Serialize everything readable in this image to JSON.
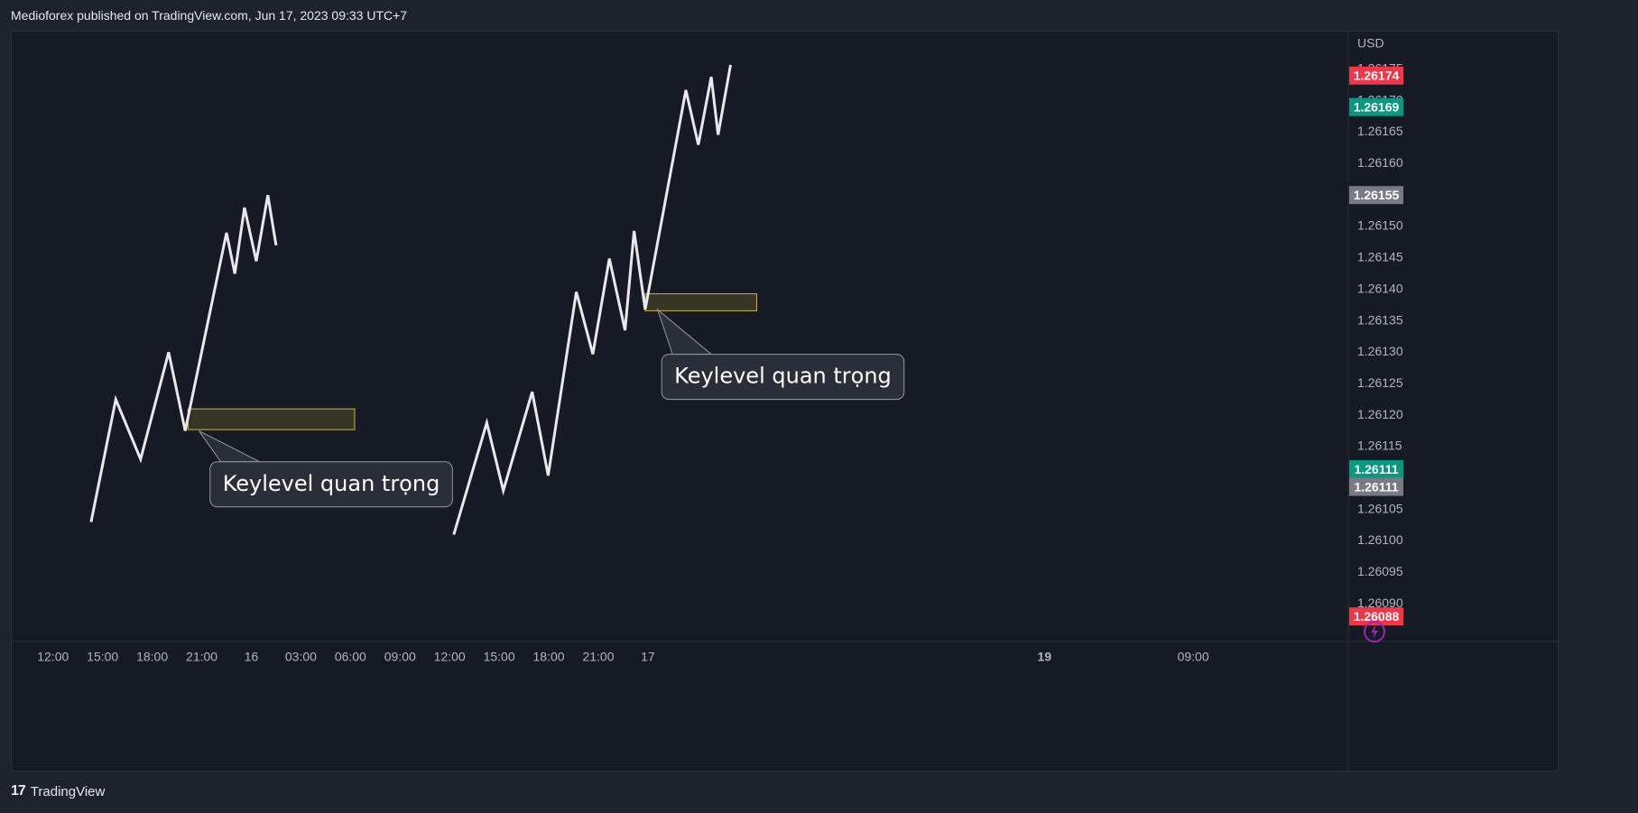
{
  "header": {
    "published": "Medioforex published on TradingView.com, Jun 17, 2023 09:33 UTC+7"
  },
  "footer": {
    "brand": "TradingView",
    "logo_icon": "tradingview-logo-icon"
  },
  "colors": {
    "line": "#e8e8ee",
    "zone_fill": "#3b3a27",
    "zone_stroke": "#c8b53a",
    "callout_bg": "#2a2e39",
    "callout_border": "#9598a1",
    "badge_red": "#f23645",
    "badge_green": "#089981",
    "badge_gray": "#787b86",
    "lightning": "#9c27b0"
  },
  "chart_data": {
    "type": "line",
    "currency": "USD",
    "price_axis": {
      "ylim": [
        1.26084,
        1.26181
      ],
      "ticks": [
        "1.26175",
        "1.26170",
        "1.26165",
        "1.26160",
        "1.26155",
        "1.26150",
        "1.26145",
        "1.26140",
        "1.26135",
        "1.26130",
        "1.26125",
        "1.26120",
        "1.26115",
        "1.26110",
        "1.26105",
        "1.26100",
        "1.26095",
        "1.26090"
      ]
    },
    "time_axis": {
      "xlim": [
        -150,
        4700
      ],
      "ticks": [
        {
          "t": 0,
          "label": "12:00",
          "bold": false
        },
        {
          "t": 180,
          "label": "15:00",
          "bold": false
        },
        {
          "t": 360,
          "label": "18:00",
          "bold": false
        },
        {
          "t": 540,
          "label": "21:00",
          "bold": false
        },
        {
          "t": 720,
          "label": "16",
          "bold": false
        },
        {
          "t": 900,
          "label": "03:00",
          "bold": false
        },
        {
          "t": 1080,
          "label": "06:00",
          "bold": false
        },
        {
          "t": 1260,
          "label": "09:00",
          "bold": false
        },
        {
          "t": 1440,
          "label": "12:00",
          "bold": false
        },
        {
          "t": 1620,
          "label": "15:00",
          "bold": false
        },
        {
          "t": 1800,
          "label": "18:00",
          "bold": false
        },
        {
          "t": 1980,
          "label": "21:00",
          "bold": false
        },
        {
          "t": 2160,
          "label": "17",
          "bold": false
        },
        {
          "t": 3600,
          "label": "19",
          "bold": true
        },
        {
          "t": 4140,
          "label": "09:00",
          "bold": false
        }
      ]
    },
    "series": [
      {
        "points": [
          [
            138,
            1.26103
          ],
          [
            228,
            1.261225
          ],
          [
            318,
            1.26113
          ],
          [
            420,
            1.2613
          ],
          [
            480,
            1.261175
          ],
          [
            630,
            1.26149
          ],
          [
            660,
            1.261425
          ],
          [
            695,
            1.26153
          ],
          [
            738,
            1.261445
          ],
          [
            780,
            1.26155
          ],
          [
            810,
            1.26147
          ]
        ]
      },
      {
        "points": [
          [
            1455,
            1.26101
          ],
          [
            1575,
            1.261188
          ],
          [
            1635,
            1.26108
          ],
          [
            1740,
            1.261237
          ],
          [
            1798,
            1.261104
          ],
          [
            1900,
            1.261396
          ],
          [
            1960,
            1.261297
          ],
          [
            2020,
            1.261449
          ],
          [
            2077,
            1.261335
          ],
          [
            2110,
            1.261493
          ],
          [
            2150,
            1.261368
          ],
          [
            2298,
            1.261717
          ],
          [
            2343,
            1.26163
          ],
          [
            2390,
            1.261738
          ],
          [
            2415,
            1.261646
          ],
          [
            2460,
            1.261757
          ]
        ]
      }
    ],
    "zones": [
      {
        "t_start": 490,
        "t_end": 1095,
        "p_low": 1.261177,
        "p_high": 1.26121
      },
      {
        "t_start": 2150,
        "t_end": 2555,
        "p_low": 1.261366,
        "p_high": 1.261393
      }
    ],
    "annotations": [
      {
        "text": "Keylevel quan trọng",
        "anchor_t": 530,
        "anchor_p": 1.261175,
        "box_t": 570,
        "box_p": 1.26109
      },
      {
        "text": "Keylevel quan trọng",
        "anchor_t": 2195,
        "anchor_p": 1.261368,
        "box_t": 2210,
        "box_p": 1.261261
      }
    ],
    "price_badges": [
      {
        "label": "1.26174",
        "value": 1.26174,
        "color": "red"
      },
      {
        "label": "1.26169",
        "value": 1.26169,
        "color": "green"
      },
      {
        "label": "1.26155",
        "value": 1.26155,
        "color": "gray"
      },
      {
        "label": "1.26111",
        "value": 1.261114,
        "color": "green"
      },
      {
        "label": "1.26111",
        "value": 1.261086,
        "color": "gray"
      },
      {
        "label": "1.26088",
        "value": 1.26088,
        "color": "red"
      }
    ]
  }
}
